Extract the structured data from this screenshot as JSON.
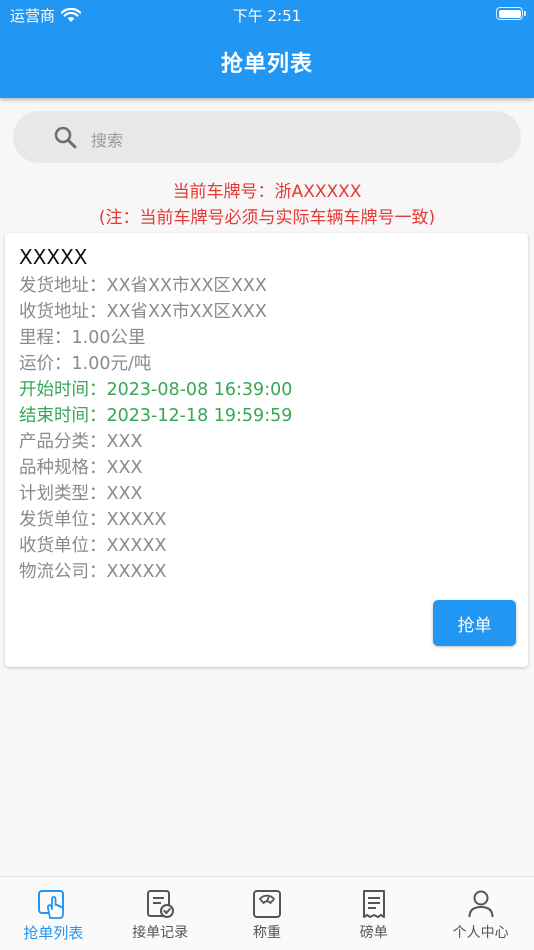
{
  "status_bar": {
    "carrier": "运营商",
    "time": "下午 2:51"
  },
  "header": {
    "title": "抢单列表"
  },
  "search": {
    "placeholder": "搜索"
  },
  "notice": {
    "plate_line": "当前车牌号：浙AXXXXX",
    "plate_note": "(注：当前车牌号必须与实际车辆车牌号一致)"
  },
  "order": {
    "title": "XXXXX",
    "fields": [
      {
        "text": "发货地址：XX省XX市XX区XXX",
        "highlight": false
      },
      {
        "text": "收货地址：XX省XX市XX区XXX",
        "highlight": false
      },
      {
        "text": "里程：1.00公里",
        "highlight": false
      },
      {
        "text": "运价：1.00元/吨",
        "highlight": false
      },
      {
        "text": "开始时间：2023-08-08 16:39:00",
        "highlight": true
      },
      {
        "text": "结束时间：2023-12-18 19:59:59",
        "highlight": true
      },
      {
        "text": "产品分类：XXX",
        "highlight": false
      },
      {
        "text": "品种规格：XXX",
        "highlight": false
      },
      {
        "text": "计划类型：XXX",
        "highlight": false
      },
      {
        "text": "发货单位：XXXXX",
        "highlight": false
      },
      {
        "text": "收货单位：XXXXX",
        "highlight": false
      },
      {
        "text": "物流公司：XXXXX",
        "highlight": false
      }
    ],
    "action_label": "抢单"
  },
  "tabs": [
    {
      "label": "抢单列表",
      "icon": "grab-order-icon",
      "active": true
    },
    {
      "label": "接单记录",
      "icon": "order-record-icon",
      "active": false
    },
    {
      "label": "称重",
      "icon": "scale-icon",
      "active": false
    },
    {
      "label": "磅单",
      "icon": "receipt-icon",
      "active": false
    },
    {
      "label": "个人中心",
      "icon": "user-icon",
      "active": false
    }
  ],
  "colors": {
    "primary": "#2196f3",
    "warning_text": "#e53935",
    "time_text": "#34a853"
  }
}
